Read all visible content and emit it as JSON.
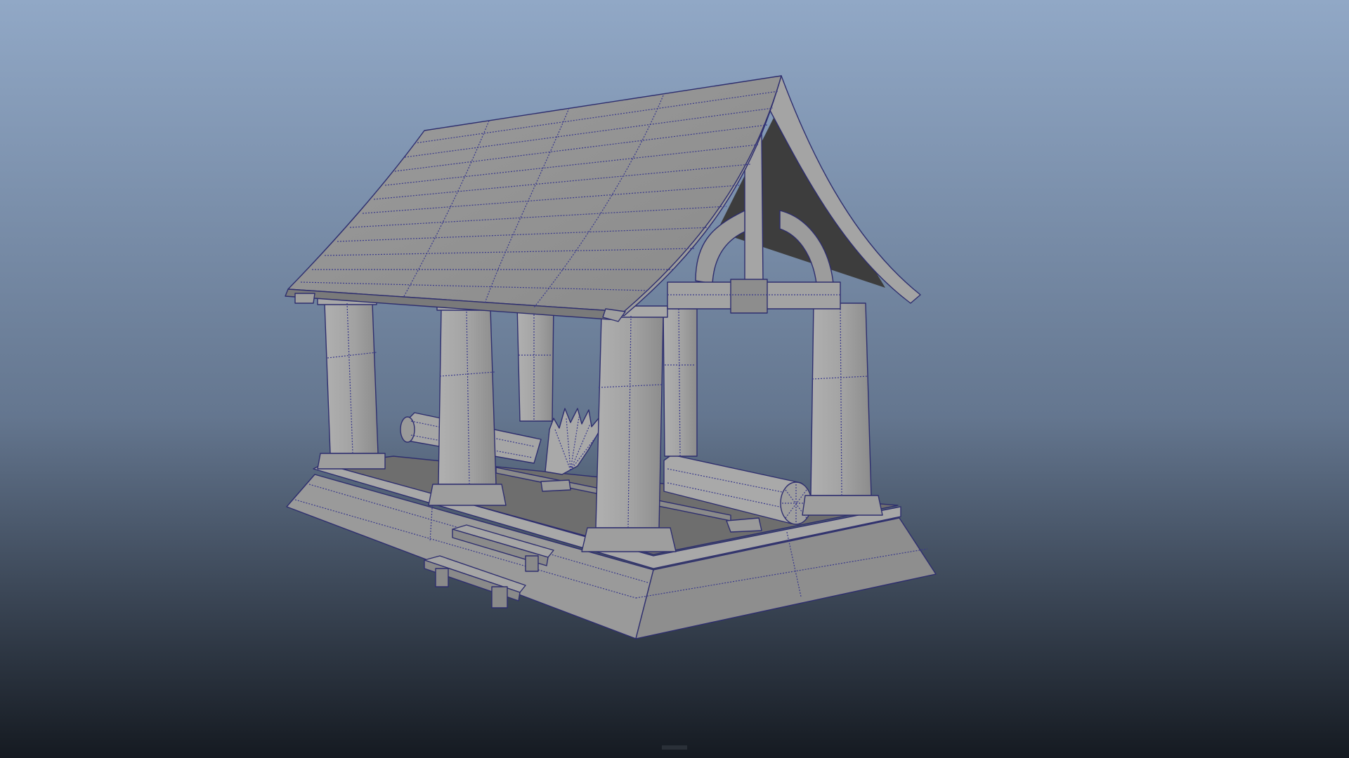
{
  "viewport": {
    "background_top": "#91a8c6",
    "background_mid": "#64768f",
    "background_bottom": "#151a21"
  },
  "model": {
    "shading": {
      "face_light": "#a3a3a3",
      "face_mid": "#8f8f8f",
      "face_dark": "#767676",
      "face_shadow": "#3d3d3d",
      "wire": "#3a3a8c"
    },
    "pillar_count": 6,
    "roof_panel_rows": 12,
    "roof_panel_columns": 4
  }
}
